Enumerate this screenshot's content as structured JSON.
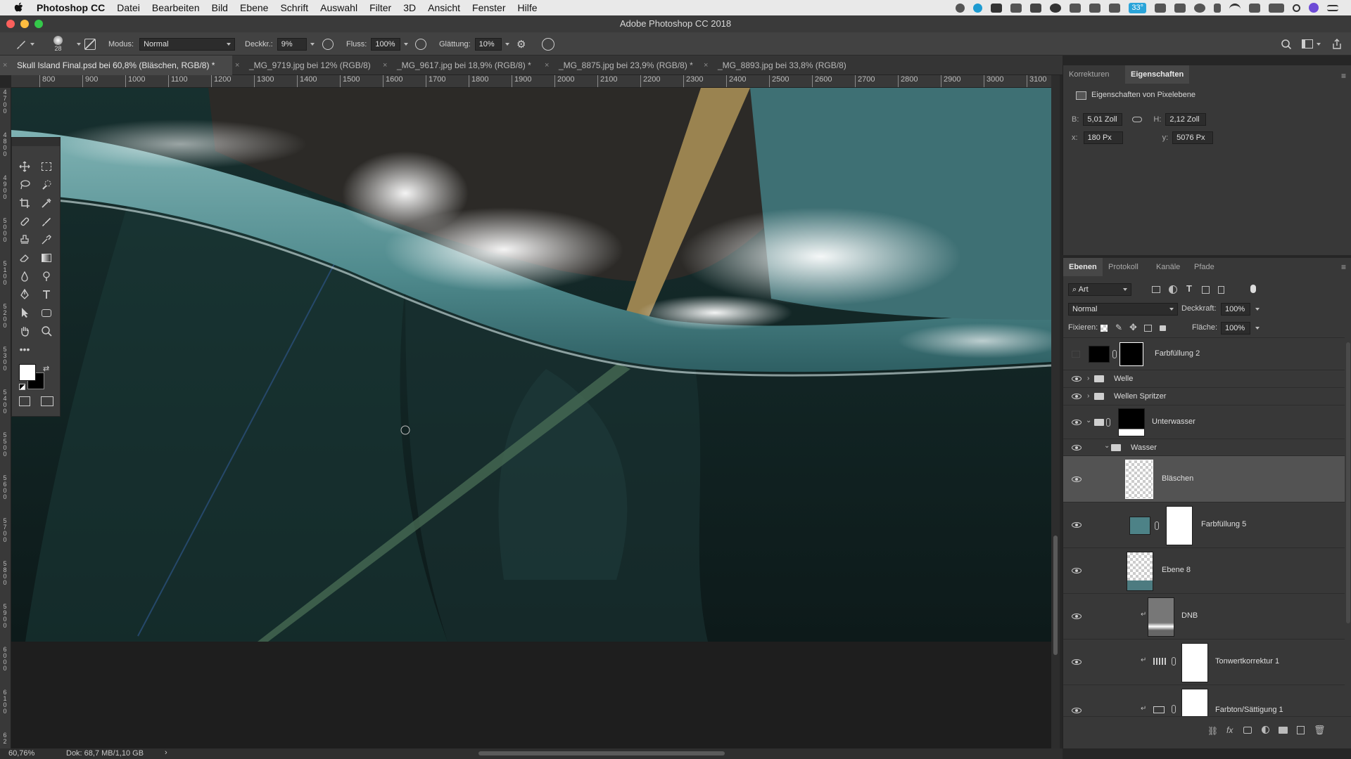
{
  "menubar": {
    "app_name": "Photoshop CC",
    "items": [
      "Datei",
      "Bearbeiten",
      "Bild",
      "Ebene",
      "Schrift",
      "Auswahl",
      "Filter",
      "3D",
      "Ansicht",
      "Fenster",
      "Hilfe"
    ],
    "status_badge": "33°"
  },
  "window": {
    "title": "Adobe Photoshop CC 2018"
  },
  "options": {
    "brush_size": "28",
    "mode_label": "Modus:",
    "mode_value": "Normal",
    "opacity_label": "Deckkr.:",
    "opacity_value": "9%",
    "flow_label": "Fluss:",
    "flow_value": "100%",
    "smoothing_label": "Glättung:",
    "smoothing_value": "10%"
  },
  "tabs": [
    {
      "label": "Skull Island Final.psd bei 60,8% (Bläschen, RGB/8) *",
      "active": true
    },
    {
      "label": "_MG_9719.jpg bei 12% (RGB/8)",
      "active": false
    },
    {
      "label": "_MG_9617.jpg bei 18,9% (RGB/8) *",
      "active": false
    },
    {
      "label": "_MG_8875.jpg bei 23,9% (RGB/8) *",
      "active": false
    },
    {
      "label": "_MG_8893.jpg bei 33,8% (RGB/8)",
      "active": false
    }
  ],
  "ruler": {
    "h_ticks": [
      "800",
      "900",
      "1000",
      "1100",
      "1200",
      "1300",
      "1400",
      "1500",
      "1600",
      "1700",
      "1800",
      "1900",
      "2000",
      "2100",
      "2200",
      "2300",
      "2400",
      "2500",
      "2600",
      "2700",
      "2800",
      "2900",
      "3000",
      "3100"
    ],
    "v_ticks": [
      "4 7 0 0",
      "4 8 0 0",
      "4 9 0 0",
      "5 0 0 0",
      "5 1 0 0",
      "5 2 0 0",
      "5 3 0 0",
      "5 4 0 0",
      "5 5 0 0",
      "5 6 0 0",
      "5 7 0 0",
      "5 8 0 0",
      "5 9 0 0",
      "6 0 0 0",
      "6 1 0 0",
      "6 2"
    ]
  },
  "properties": {
    "tabs": [
      "Korrekturen",
      "Eigenschaften"
    ],
    "heading": "Eigenschaften von Pixelebene",
    "w_label": "B:",
    "w_value": "5,01 Zoll",
    "h_label": "H:",
    "h_value": "2,12 Zoll",
    "x_label": "x:",
    "x_value": "180 Px",
    "y_label": "y:",
    "y_value": "5076 Px"
  },
  "layers_panel": {
    "tabs": [
      "Ebenen",
      "Protokoll",
      "Kanäle",
      "Pfade"
    ],
    "filter": "Art",
    "blend_mode": "Normal",
    "opacity_label": "Deckkraft:",
    "opacity_value": "100%",
    "lock_label": "Fixieren:",
    "fill_label": "Fläche:",
    "fill_value": "100%",
    "layers": [
      {
        "name": "Farbfüllung 2",
        "visible": false
      },
      {
        "name": "Welle",
        "visible": true
      },
      {
        "name": "Wellen Spritzer",
        "visible": true
      },
      {
        "name": "Unterwasser",
        "visible": true
      },
      {
        "name": "Wasser",
        "visible": true
      },
      {
        "name": "Bläschen",
        "visible": true,
        "selected": true
      },
      {
        "name": "Farbfüllung 5",
        "visible": true
      },
      {
        "name": "Ebene 8",
        "visible": true
      },
      {
        "name": "DNB",
        "visible": true
      },
      {
        "name": "Tonwertkorrektur 1",
        "visible": true
      },
      {
        "name": "Farbton/Sättigung 1",
        "visible": true
      }
    ]
  },
  "status": {
    "zoom": "60,76%",
    "doc_info": "Dok: 68,7 MB/1,10 GB"
  }
}
